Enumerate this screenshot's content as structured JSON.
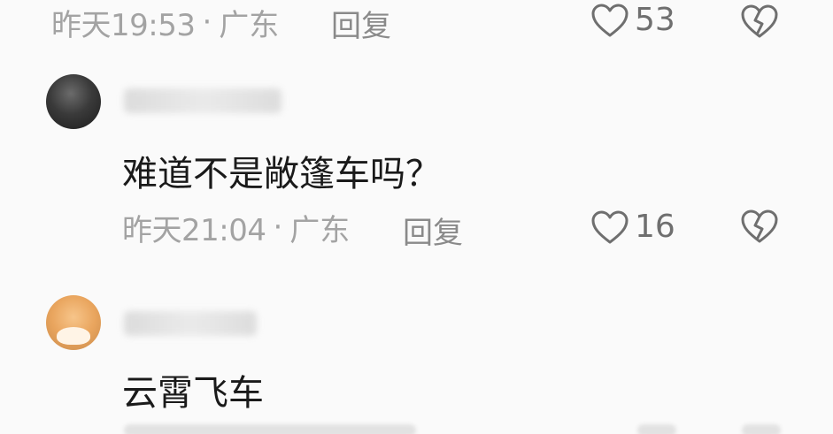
{
  "comments": [
    {
      "time": "昨天19:53",
      "dot": "·",
      "location": "广东",
      "reply_label": "回复",
      "likes": "53",
      "icons": {
        "like": "heart-outline-icon",
        "dislike": "broken-heart-icon"
      }
    },
    {
      "avatar_style": "dark-photo",
      "text": "难道不是敞篷车吗？",
      "time": "昨天21:04",
      "dot": "·",
      "location": "广东",
      "reply_label": "回复",
      "likes": "16",
      "icons": {
        "like": "heart-outline-icon",
        "dislike": "broken-heart-icon"
      }
    },
    {
      "avatar_style": "orange-cartoon",
      "text": "云霄飞车"
    }
  ],
  "colors": {
    "background": "#fafafa",
    "meta_text": "#a3a3a3",
    "comment_text": "#1a1a1a",
    "icon_stroke": "#6f6f6f"
  }
}
